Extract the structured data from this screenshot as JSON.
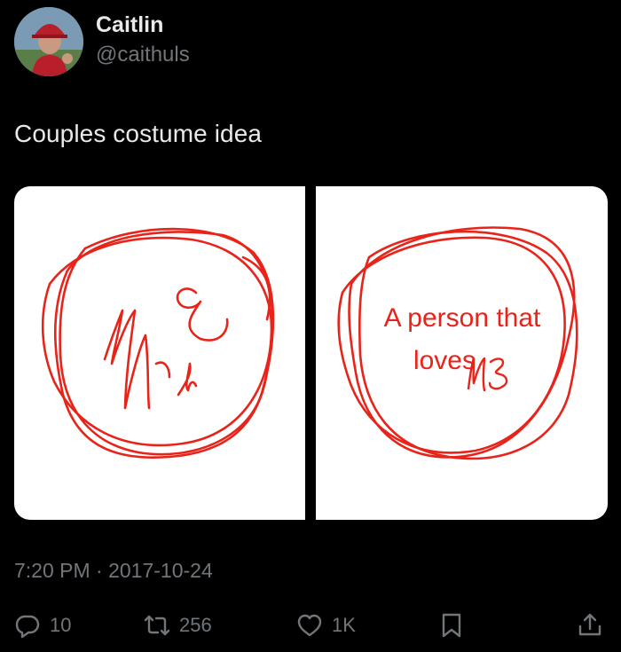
{
  "author": {
    "display_name": "Caitlin",
    "handle": "@caithuls"
  },
  "tweet": {
    "text": "Couples costume idea",
    "timestamp": "7:20 PM · 2017-10-24"
  },
  "media": {
    "left_panel": {
      "scribble": "ME"
    },
    "right_panel": {
      "line1": "A person that",
      "line2": "loves",
      "scribble": "ME"
    },
    "ink_color": "#e8241a"
  },
  "actions": {
    "replies": "10",
    "retweets": "256",
    "likes": "1K"
  },
  "icons": [
    "reply-icon",
    "retweet-icon",
    "like-icon",
    "bookmark-icon",
    "share-icon"
  ]
}
